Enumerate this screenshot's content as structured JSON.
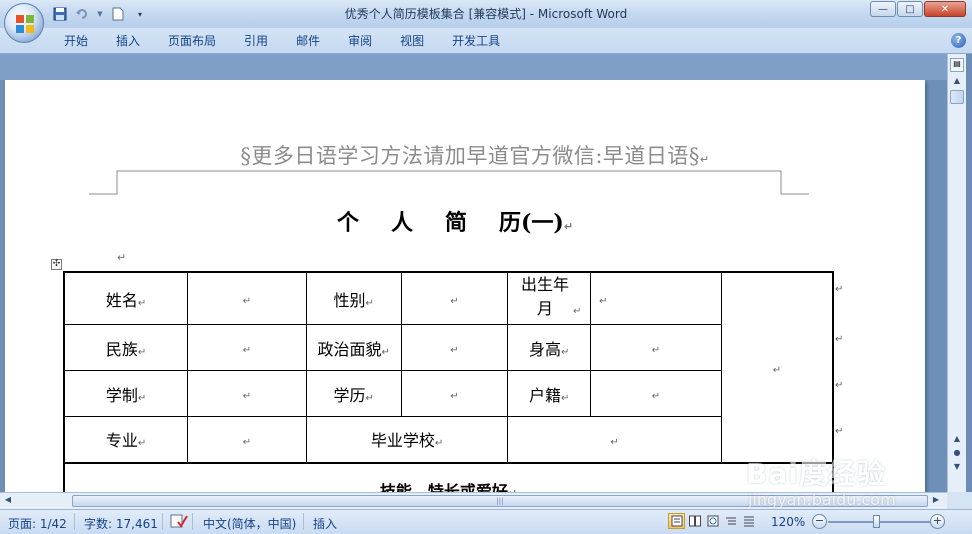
{
  "window": {
    "title": "优秀个人简历模板集合 [兼容模式] - Microsoft Word",
    "controls": {
      "minimize": "—",
      "maximize": "□",
      "close": "✕"
    }
  },
  "qat": {
    "icons": [
      "save-icon",
      "undo-icon",
      "new-document-icon",
      "customize-icon"
    ]
  },
  "ribbon": {
    "tabs": [
      "开始",
      "插入",
      "页面布局",
      "引用",
      "邮件",
      "审阅",
      "视图",
      "开发工具"
    ],
    "help_label": "?"
  },
  "document": {
    "header_text": "§更多日语学习方法请加早道官方微信:早道日语§",
    "title_chars": [
      "个",
      "人",
      "简",
      "历(一)"
    ],
    "paragraph_mark": "↵",
    "table": {
      "rows": [
        [
          "姓名",
          "",
          "性别",
          "",
          "出生年月",
          "",
          ""
        ],
        [
          "民族",
          "",
          "政治面貌",
          "",
          "身高",
          ""
        ],
        [
          "学制",
          "",
          "学历",
          "",
          "户籍",
          ""
        ],
        [
          "专业",
          "",
          "毕业学校",
          ""
        ]
      ],
      "skills_heading": "技能、特长或爱好"
    }
  },
  "statusbar": {
    "page": "页面: 1/42",
    "words": "字数: 17,461",
    "language": "中文(简体，中国)",
    "mode": "插入",
    "zoom": "120%",
    "zoom_minus": "−",
    "zoom_plus": "+"
  },
  "watermark": {
    "logo": "Bai度经验",
    "url": "jingyan.baidu.com"
  },
  "colors": {
    "ribbon_text": "#15428b",
    "doc_background": "#6e8fb7",
    "header_text": "#8c8c8c"
  }
}
